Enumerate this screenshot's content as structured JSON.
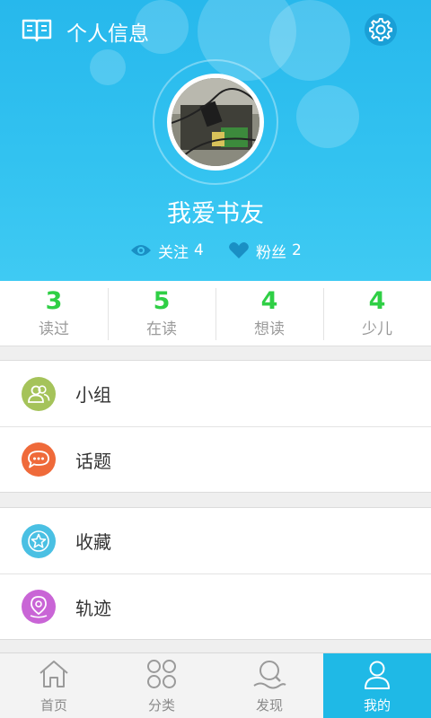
{
  "header": {
    "title": "个人信息",
    "book_icon": "open-book-icon",
    "settings_icon": "gear-icon",
    "username": "我爱书友",
    "follow_label": "关注",
    "follow_count": "4",
    "fans_label": "粉丝",
    "fans_count": "2"
  },
  "stats": [
    {
      "value": "3",
      "label": "读过"
    },
    {
      "value": "5",
      "label": "在读"
    },
    {
      "value": "4",
      "label": "想读"
    },
    {
      "value": "4",
      "label": "少儿"
    }
  ],
  "menu_groups": [
    [
      {
        "label": "小组",
        "icon": "group-icon",
        "color": "#a5c35a"
      },
      {
        "label": "话题",
        "icon": "chat-bubble-icon",
        "color": "#ef6a3a"
      }
    ],
    [
      {
        "label": "收藏",
        "icon": "star-icon",
        "color": "#4ac0e3"
      },
      {
        "label": "轨迹",
        "icon": "location-pin-icon",
        "color": "#c965d6"
      }
    ]
  ],
  "tabs": [
    {
      "label": "首页",
      "icon": "home-icon",
      "active": false
    },
    {
      "label": "分类",
      "icon": "grid-circles-icon",
      "active": false
    },
    {
      "label": "发现",
      "icon": "discover-search-icon",
      "active": false
    },
    {
      "label": "我的",
      "icon": "user-icon",
      "active": true
    }
  ],
  "colors": {
    "header_blue": "#2fbfee",
    "stat_green": "#2fcf45",
    "active_tab": "#1fb9e6"
  }
}
